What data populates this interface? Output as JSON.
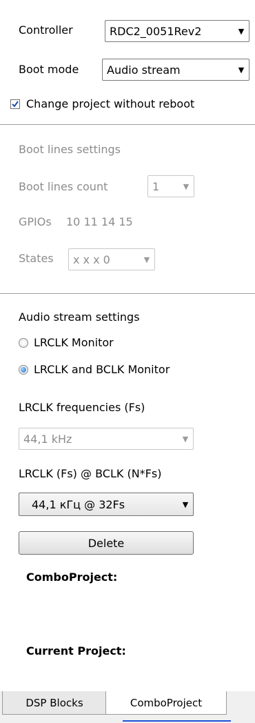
{
  "controller": {
    "label": "Controller",
    "value": "RDC2_0051Rev2",
    "arrow_icon": "▼"
  },
  "boot_mode": {
    "label": "Boot mode",
    "value": "Audio stream",
    "arrow_icon": "▼"
  },
  "change_project_checkbox": {
    "label": "Change project without reboot",
    "checked": true
  },
  "boot_lines": {
    "heading": "Boot lines settings",
    "count_label": "Boot lines count",
    "count_value": "1",
    "gpios_label": "GPIOs",
    "gpios_values": "10 11 14 15",
    "states_label": "States",
    "states_value": "x x x 0",
    "arrow_icon": "▼"
  },
  "audio_stream": {
    "heading": "Audio stream settings",
    "radio_options": [
      {
        "label": "LRCLK Monitor",
        "selected": false
      },
      {
        "label": "LRCLK and BCLK Monitor",
        "selected": true
      }
    ],
    "frequencies_label": "LRCLK frequencies (Fs)",
    "frequencies_value": "44,1 kHz",
    "bclk_label": "LRCLK (Fs) @ BCLK (N*Fs)",
    "bclk_value": "44,1 кГц @ 32Fs",
    "delete_button": "Delete",
    "arrow_icon": "▼"
  },
  "combo_project_label": "ComboProject:",
  "current_project_label": "Current Project:",
  "tabs": [
    {
      "label": "DSP Blocks",
      "active": false
    },
    {
      "label": "ComboProject",
      "active": true
    }
  ],
  "colors": {
    "disabled_text": "#8c8c8c",
    "radio_selected": "#1a6fc7",
    "tab_underline": "#1a4fd6"
  }
}
